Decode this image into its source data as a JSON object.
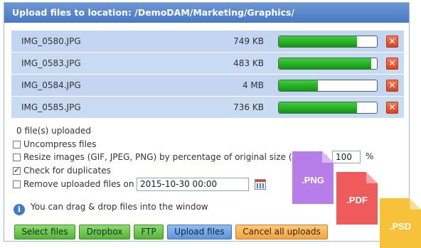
{
  "title": "Upload files to location: /DemoDAM/Marketing/Graphics/",
  "files": [
    {
      "name": "IMG_0580.JPG",
      "size": "749 KB",
      "progress": 0.8
    },
    {
      "name": "IMG_0583.JPG",
      "size": "483 KB",
      "progress": 0.94
    },
    {
      "name": "IMG_0584.JPG",
      "size": "4 MB",
      "progress": 0.4
    },
    {
      "name": "IMG_0585.JPG",
      "size": "736 KB",
      "progress": 0.8
    }
  ],
  "status_text": "0 file(s) uploaded",
  "options": {
    "uncompress": {
      "label": "Uncompress files",
      "checked": false
    },
    "resize": {
      "label": "Resize images (GIF, JPEG, PNG) by percentage of original size (",
      "label_end": "):",
      "value": "100",
      "unit": "%",
      "checked": false
    },
    "duplicates": {
      "label": "Check for duplicates",
      "checked": true
    },
    "remove": {
      "label": "Remove uploaded files on",
      "date_value": "2015-10-30 00:00",
      "checked": false
    }
  },
  "info_text": "You can drag & drop files into the window",
  "buttons": {
    "select_files": "Select files",
    "dropbox": "Dropbox",
    "ftp": "FTP",
    "upload_files": "Upload files",
    "cancel_all": "Cancel all uploads"
  },
  "file_icons": [
    {
      "label": ".PNG",
      "color": "#b77ee9"
    },
    {
      "label": ".PDF",
      "color": "#ef5a5a"
    },
    {
      "label": ".PSD",
      "color": "#f7c23a"
    }
  ],
  "colors": {
    "titlebar": "#4f7dc6",
    "row_background": "#c9daf3",
    "progress_fill": "#2ab52a",
    "remove_button": "#e0532f"
  }
}
